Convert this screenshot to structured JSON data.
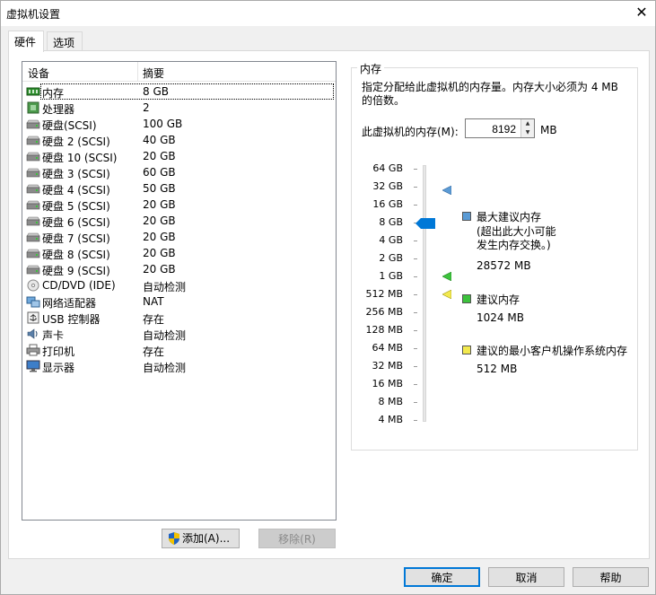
{
  "window": {
    "title": "虚拟机设置",
    "close_glyph": "✕"
  },
  "tabs": [
    {
      "label": "硬件"
    },
    {
      "label": "选项"
    }
  ],
  "device_list": {
    "columns": {
      "device": "设备",
      "summary": "摘要"
    },
    "rows": [
      {
        "name": "内存",
        "summary": "8 GB",
        "icon": "memory-icon"
      },
      {
        "name": "处理器",
        "summary": "2",
        "icon": "processor-icon"
      },
      {
        "name": "硬盘(SCSI)",
        "summary": "100 GB",
        "icon": "hard-disk-icon"
      },
      {
        "name": "硬盘 2 (SCSI)",
        "summary": "40 GB",
        "icon": "hard-disk-icon"
      },
      {
        "name": "硬盘 10 (SCSI)",
        "summary": "20 GB",
        "icon": "hard-disk-icon"
      },
      {
        "name": "硬盘 3 (SCSI)",
        "summary": "60 GB",
        "icon": "hard-disk-icon"
      },
      {
        "name": "硬盘 4 (SCSI)",
        "summary": "50 GB",
        "icon": "hard-disk-icon"
      },
      {
        "name": "硬盘 5 (SCSI)",
        "summary": "20 GB",
        "icon": "hard-disk-icon"
      },
      {
        "name": "硬盘 6 (SCSI)",
        "summary": "20 GB",
        "icon": "hard-disk-icon"
      },
      {
        "name": "硬盘 7 (SCSI)",
        "summary": "20 GB",
        "icon": "hard-disk-icon"
      },
      {
        "name": "硬盘 8 (SCSI)",
        "summary": "20 GB",
        "icon": "hard-disk-icon"
      },
      {
        "name": "硬盘 9 (SCSI)",
        "summary": "20 GB",
        "icon": "hard-disk-icon"
      },
      {
        "name": "CD/DVD (IDE)",
        "summary": "自动检测",
        "icon": "cd-dvd-icon"
      },
      {
        "name": "网络适配器",
        "summary": "NAT",
        "icon": "network-adapter-icon"
      },
      {
        "name": "USB 控制器",
        "summary": "存在",
        "icon": "usb-icon"
      },
      {
        "name": "声卡",
        "summary": "自动检测",
        "icon": "speaker-icon"
      },
      {
        "name": "打印机",
        "summary": "存在",
        "icon": "printer-icon"
      },
      {
        "name": "显示器",
        "summary": "自动检测",
        "icon": "monitor-icon"
      }
    ],
    "add_button": "添加(A)...",
    "remove_button": "移除(R)"
  },
  "memory": {
    "group_title": "内存",
    "description": "指定分配给此虚拟机的内存量。内存大小必须为 4 MB 的倍数。",
    "input_label": "此虚拟机的内存(M):",
    "input_value": "8192",
    "unit": "MB",
    "scale_labels": [
      "64 GB",
      "32 GB",
      "16 GB",
      "8 GB",
      "4 GB",
      "2 GB",
      "1 GB",
      "512 MB",
      "256 MB",
      "128 MB",
      "64 MB",
      "32 MB",
      "16 MB",
      "8 MB",
      "4 MB"
    ],
    "selected_label": "8 GB",
    "max_recommended": {
      "title": "最大建议内存",
      "note_line1": "(超出此大小可能",
      "note_line2": "发生内存交换。)",
      "value": "28572 MB",
      "color": "#5b9bd5"
    },
    "recommended": {
      "title": "建议内存",
      "value": "1024 MB",
      "color": "#3cc23c"
    },
    "min_recommended": {
      "title": "建议的最小客户机操作系统内存",
      "value": "512 MB",
      "color": "#f2e94e"
    }
  },
  "dialog_buttons": {
    "ok": "确定",
    "cancel": "取消",
    "help": "帮助"
  },
  "colors": {
    "thumb": "#0078d7",
    "selection_border": "#000000",
    "default_button_border": "#0078d7"
  }
}
